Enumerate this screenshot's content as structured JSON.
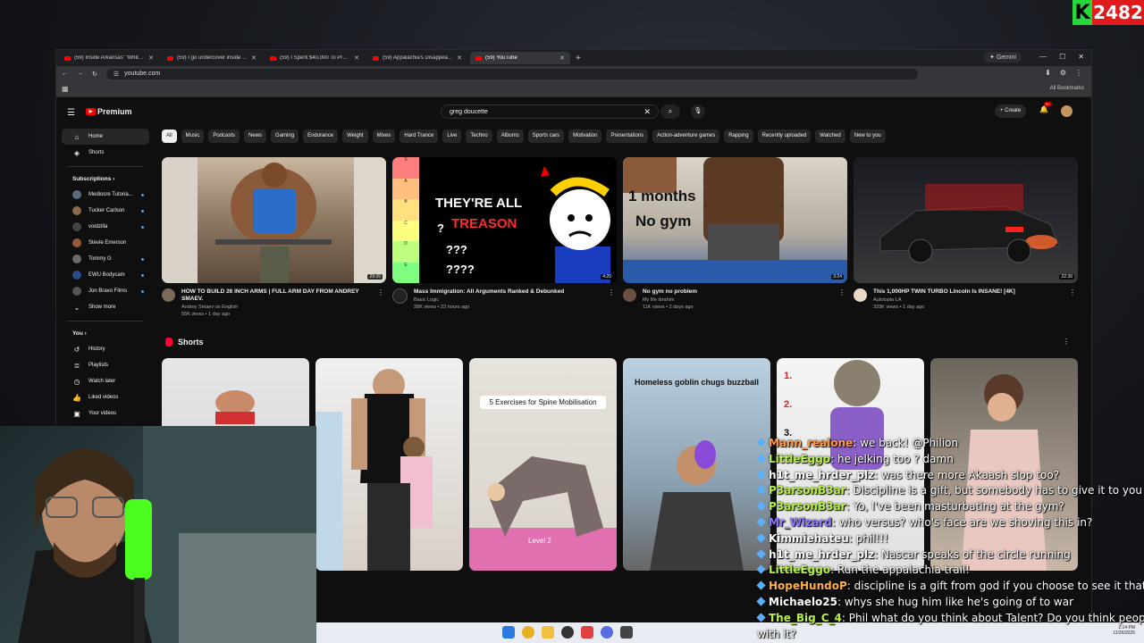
{
  "overlay_badge": {
    "letter": "K",
    "value": "2482"
  },
  "browser": {
    "tabs": [
      {
        "label": "(59) Inside Arkansas' \"Whites O"
      },
      {
        "label": "(59) I go undercover inside the"
      },
      {
        "label": "(59) I Spent $40,000 To Prove T"
      },
      {
        "label": "(59) Appalachia's Disappearing"
      },
      {
        "label": "(59) YouTube"
      }
    ],
    "gemini": "Gemini",
    "url": "youtube.com",
    "all_bookmarks": "All Bookmarks"
  },
  "youtube": {
    "logo": "Premium",
    "search_value": "greg doucette",
    "create": "Create",
    "notif_count": "9+",
    "sidebar": {
      "main": [
        {
          "label": "Home"
        },
        {
          "label": "Shorts"
        }
      ],
      "subs_title": "Subscriptions",
      "subs": [
        {
          "label": "Mediocre Tutoria...",
          "color": "#5a6b7c"
        },
        {
          "label": "Tucker Carlson",
          "color": "#8a6a4a"
        },
        {
          "label": "voidzilla",
          "color": "#444"
        },
        {
          "label": "Stevie Emerson",
          "color": "#9a5a3a"
        },
        {
          "label": "Tommy G",
          "color": "#6a6a6a"
        },
        {
          "label": "EWU Bodycam",
          "color": "#2a4a8a"
        },
        {
          "label": "Jon Bravo Films",
          "color": "#555"
        }
      ],
      "show_more": "Show more",
      "you_title": "You",
      "you": [
        {
          "label": "History"
        },
        {
          "label": "Playlists"
        },
        {
          "label": "Watch later"
        },
        {
          "label": "Liked videos"
        },
        {
          "label": "Your videos"
        }
      ]
    },
    "chips": [
      "All",
      "Music",
      "Podcasts",
      "News",
      "Gaming",
      "Endurance",
      "Weight",
      "Mixes",
      "Hard Trance",
      "Live",
      "Techno",
      "Albums",
      "Sports cars",
      "Motivation",
      "Presentations",
      "Action-adventure games",
      "Rapping",
      "Recently uploaded",
      "Watched",
      "New to you"
    ],
    "videos": [
      {
        "title": "HOW TO BUILD 26 INCH ARMS | FULL ARM DAY FROM ANDREY SMAEV.",
        "channel": "Andrey Smaev on English",
        "meta": "55K views • 1 day ago",
        "duration": "29:35"
      },
      {
        "title": "Mass Immigration: All Arguments Ranked & Debunked",
        "channel": "Basic Logic",
        "meta": "28K views • 23 hours ago",
        "duration": "4:20",
        "overlay1": "THEY'RE ALL",
        "overlay2": "TREASON",
        "q1": "?",
        "q2": "???",
        "q3": "????",
        "tiers": [
          "S",
          "A",
          "B",
          "C",
          "D",
          "E"
        ]
      },
      {
        "title": "No gym no problem",
        "channel": "My life ibrahim",
        "meta": "11K views • 2 days ago",
        "duration": "3:24",
        "overlay1": "1 months",
        "overlay2": "No gym"
      },
      {
        "title": "This 1,000HP TWIN TURBO Lincoln Is INSANE! [4K]",
        "channel": "Autotopia LA",
        "meta": "333K views • 1 day ago",
        "duration": "22:36"
      }
    ],
    "shorts_title": "Shorts",
    "shorts": [
      {
        "caption": ""
      },
      {
        "caption": ""
      },
      {
        "caption": "5 Exercises for Spine Mobilisation",
        "sub": "Level 2"
      },
      {
        "caption": "Homeless goblin chugs buzzball"
      },
      {
        "caption": "",
        "n1": "1.",
        "n2": "2.",
        "n3": "3."
      },
      {
        "caption": ""
      }
    ]
  },
  "chat": [
    {
      "user": "Mann_realone",
      "color": "#ff9a40",
      "text": "we back! @Philion"
    },
    {
      "user": "LittleEggo",
      "color": "#b8f040",
      "text": "he jelking too ? damn"
    },
    {
      "user": "h1t_me_hrder_plz",
      "color": "#ffffff",
      "text": "was there more Akaash slop too?"
    },
    {
      "user": "P3arsonB3ar",
      "color": "#b8f040",
      "text": "Discipline is a gift, but somebody has to give it to you"
    },
    {
      "user": "P3arsonB3ar",
      "color": "#b8f040",
      "text": "Yo, I've been masturbating at the gym?"
    },
    {
      "user": "Mr_Wizard",
      "color": "#8f7bff",
      "text": "who versus? who's face are we shoving this in?"
    },
    {
      "user": "Kimmiehateu",
      "color": "#ffffff",
      "text": "phil!!!"
    },
    {
      "user": "h1t_me_hrder_plz",
      "color": "#ffffff",
      "text": "Nascar speaks of the circle running"
    },
    {
      "user": "LittleEggo",
      "color": "#b8f040",
      "text": "Run the appalachia trail!"
    },
    {
      "user": "HopeHundoP",
      "color": "#ffb040",
      "text": "discipline is a gift from god if you choose to see it that way"
    },
    {
      "user": "Michaelo25",
      "color": "#ffffff",
      "text": "whys she hug him like he's going of to war"
    },
    {
      "user": "The_Big_C_4",
      "color": "#b8f040",
      "text": "Phil what do you think about Talent? Do you think people are b"
    },
    {
      "user": "",
      "color": "#ffffff",
      "text": "with it?"
    }
  ],
  "taskbar": {
    "time": "2:14 PM",
    "date": "11/26/2025"
  }
}
